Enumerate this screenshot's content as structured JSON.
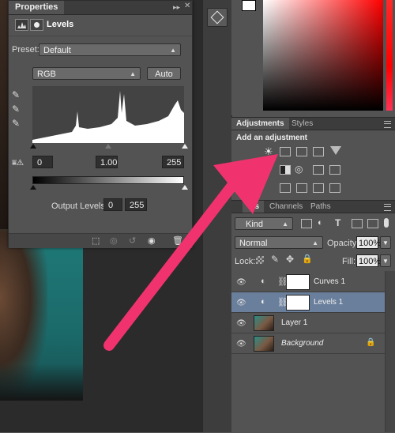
{
  "properties_panel": {
    "tab_title": "Properties",
    "panel_title": "Levels",
    "preset_label": "Preset:",
    "preset_value": "Default",
    "channel_value": "RGB",
    "auto_button": "Auto",
    "input_black": "0",
    "input_gamma": "1.00",
    "input_white": "255",
    "output_label": "Output Levels:",
    "output_black": "0",
    "output_white": "255"
  },
  "adjustments_panel": {
    "tabs": [
      "Adjustments",
      "Styles"
    ],
    "heading": "Add an adjustment"
  },
  "layers_panel": {
    "tabs": [
      "ers",
      "Channels",
      "Paths"
    ],
    "filter_kind": "Kind",
    "blend_mode": "Normal",
    "opacity_label": "Opacity:",
    "opacity_value": "100%",
    "lock_label": "Lock:",
    "fill_label": "Fill:",
    "fill_value": "100%",
    "layers": [
      {
        "name": "Curves 1",
        "type": "adjustment",
        "selected": false
      },
      {
        "name": "Levels 1",
        "type": "adjustment",
        "selected": true
      },
      {
        "name": "Layer 1",
        "type": "pixel",
        "selected": false
      },
      {
        "name": "Background",
        "type": "pixel",
        "selected": false,
        "locked": true
      }
    ]
  },
  "colors": {
    "arrow": "#f0336e",
    "selected_layer": "#6a7f9c",
    "photo_teal": "#1f7a78"
  }
}
